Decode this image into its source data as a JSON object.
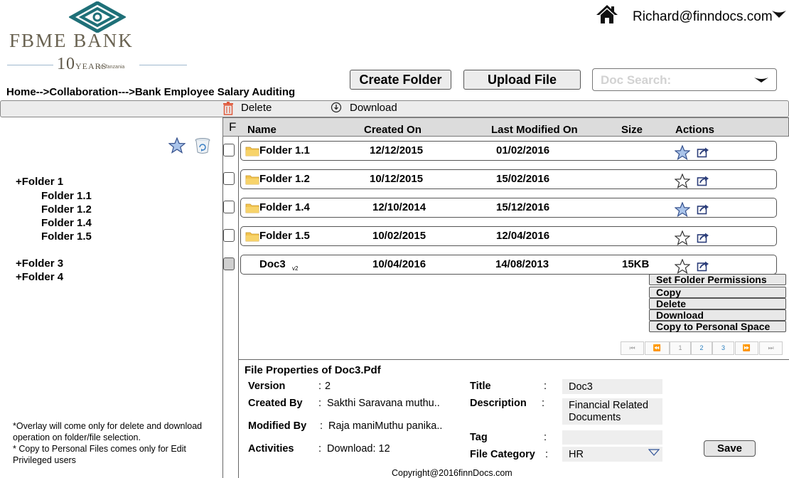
{
  "logo": {
    "name": "FBME BANK",
    "years_number": "10",
    "years_word": "YEARS",
    "years_sub": "in Tanzania"
  },
  "user": {
    "email": "Richard@finndocs.com"
  },
  "breadcrumb": "Home-->Collaboration--->Bank Employee Salary Auditing",
  "header_buttons": {
    "create_folder": "Create Folder",
    "upload_file": "Upload File"
  },
  "search": {
    "placeholder": "Doc Search:"
  },
  "toolbar": {
    "delete": "Delete",
    "download": "Download"
  },
  "table": {
    "select_header": "F",
    "headers": [
      "Name",
      "Created On",
      "Last Modified On",
      "Size",
      "Actions"
    ],
    "rows": [
      {
        "name": "Folder 1.1",
        "created": "12/12/2015",
        "modified": "01/02/2016",
        "size": "",
        "starred": true
      },
      {
        "name": "Folder 1.2",
        "created": "10/12/2015",
        "modified": "15/02/2016",
        "size": "",
        "starred": false
      },
      {
        "name": "Folder 1.4",
        "created": "12/10/2014",
        "modified": "15/12/2016",
        "size": "",
        "starred": true
      },
      {
        "name": "Folder 1.5",
        "created": "10/02/2015",
        "modified": "12/04/2016",
        "size": "",
        "starred": false
      },
      {
        "name": "Doc3",
        "version": "v2",
        "created": "10/04/2016",
        "modified": "14/08/2013",
        "size": "15KB",
        "starred": false
      }
    ]
  },
  "context_menu": [
    "Set Folder Permissions",
    "Copy",
    "Delete",
    "Download",
    "Copy to Personal Space"
  ],
  "pagination": [
    "1",
    "2",
    "3"
  ],
  "tree": {
    "folder1": "+Folder 1",
    "children": [
      "Folder 1.1",
      "Folder 1.2",
      "Folder 1.4",
      "Folder 1.5"
    ],
    "folder3": "+Folder 3",
    "folder4": "+Folder 4"
  },
  "notes": [
    "*Overlay will come only for delete and download",
    "operation on folder/file selection.",
    "* Copy to Personal Files comes only for Edit",
    "Privileged users"
  ],
  "properties": {
    "title": "File Properties of Doc3.Pdf",
    "version_label": "Version",
    "version_value": "2",
    "created_by_label": "Created By",
    "created_by_value": "Sakthi Saravana muthu..",
    "modified_by_label": "Modified By",
    "modified_by_value": "Raja maniMuthu panika..",
    "activities_label": "Activities",
    "activities_value": "Download: 12",
    "title_label": "Title",
    "title_value": "Doc3",
    "description_label": "Description",
    "description_value_1": "Financial Related",
    "description_value_2": "Documents",
    "tag_label": "Tag",
    "tag_value": "",
    "category_label": "File Category",
    "category_value": "HR",
    "colon": ":",
    "save": "Save"
  },
  "footer": "Copyright@2016finnDocs.com",
  "colors": {
    "folder": "#f2c44f",
    "star_fill": "#aac4ea",
    "star_stroke": "#334f8c",
    "delete_icon": "#e0583a",
    "logo_teal": "#1f7078"
  }
}
